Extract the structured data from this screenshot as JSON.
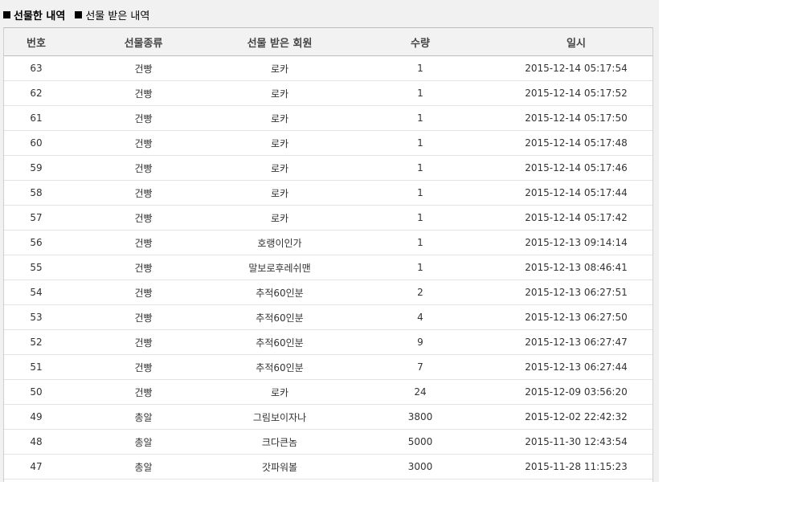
{
  "tabs": [
    {
      "label": "선물한 내역",
      "active": true
    },
    {
      "label": "선물 받은 내역",
      "active": false
    }
  ],
  "table": {
    "headers": [
      "번호",
      "선물종류",
      "선물 받은 회원",
      "수량",
      "일시"
    ],
    "rows": [
      [
        "63",
        "건빵",
        "로카",
        "1",
        "2015-12-14 05:17:54"
      ],
      [
        "62",
        "건빵",
        "로카",
        "1",
        "2015-12-14 05:17:52"
      ],
      [
        "61",
        "건빵",
        "로카",
        "1",
        "2015-12-14 05:17:50"
      ],
      [
        "60",
        "건빵",
        "로카",
        "1",
        "2015-12-14 05:17:48"
      ],
      [
        "59",
        "건빵",
        "로카",
        "1",
        "2015-12-14 05:17:46"
      ],
      [
        "58",
        "건빵",
        "로카",
        "1",
        "2015-12-14 05:17:44"
      ],
      [
        "57",
        "건빵",
        "로카",
        "1",
        "2015-12-14 05:17:42"
      ],
      [
        "56",
        "건빵",
        "호랭이인가",
        "1",
        "2015-12-13 09:14:14"
      ],
      [
        "55",
        "건빵",
        "말보로후레쉬맨",
        "1",
        "2015-12-13 08:46:41"
      ],
      [
        "54",
        "건빵",
        "추적60인분",
        "2",
        "2015-12-13 06:27:51"
      ],
      [
        "53",
        "건빵",
        "추적60인분",
        "4",
        "2015-12-13 06:27:50"
      ],
      [
        "52",
        "건빵",
        "추적60인분",
        "9",
        "2015-12-13 06:27:47"
      ],
      [
        "51",
        "건빵",
        "추적60인분",
        "7",
        "2015-12-13 06:27:44"
      ],
      [
        "50",
        "건빵",
        "로카",
        "24",
        "2015-12-09 03:56:20"
      ],
      [
        "49",
        "총알",
        "그림보이자나",
        "3800",
        "2015-12-02 22:42:32"
      ],
      [
        "48",
        "총알",
        "크다큰놈",
        "5000",
        "2015-11-30 12:43:54"
      ],
      [
        "47",
        "총알",
        "갓파워볼",
        "3000",
        "2015-11-28 11:15:23"
      ]
    ]
  }
}
